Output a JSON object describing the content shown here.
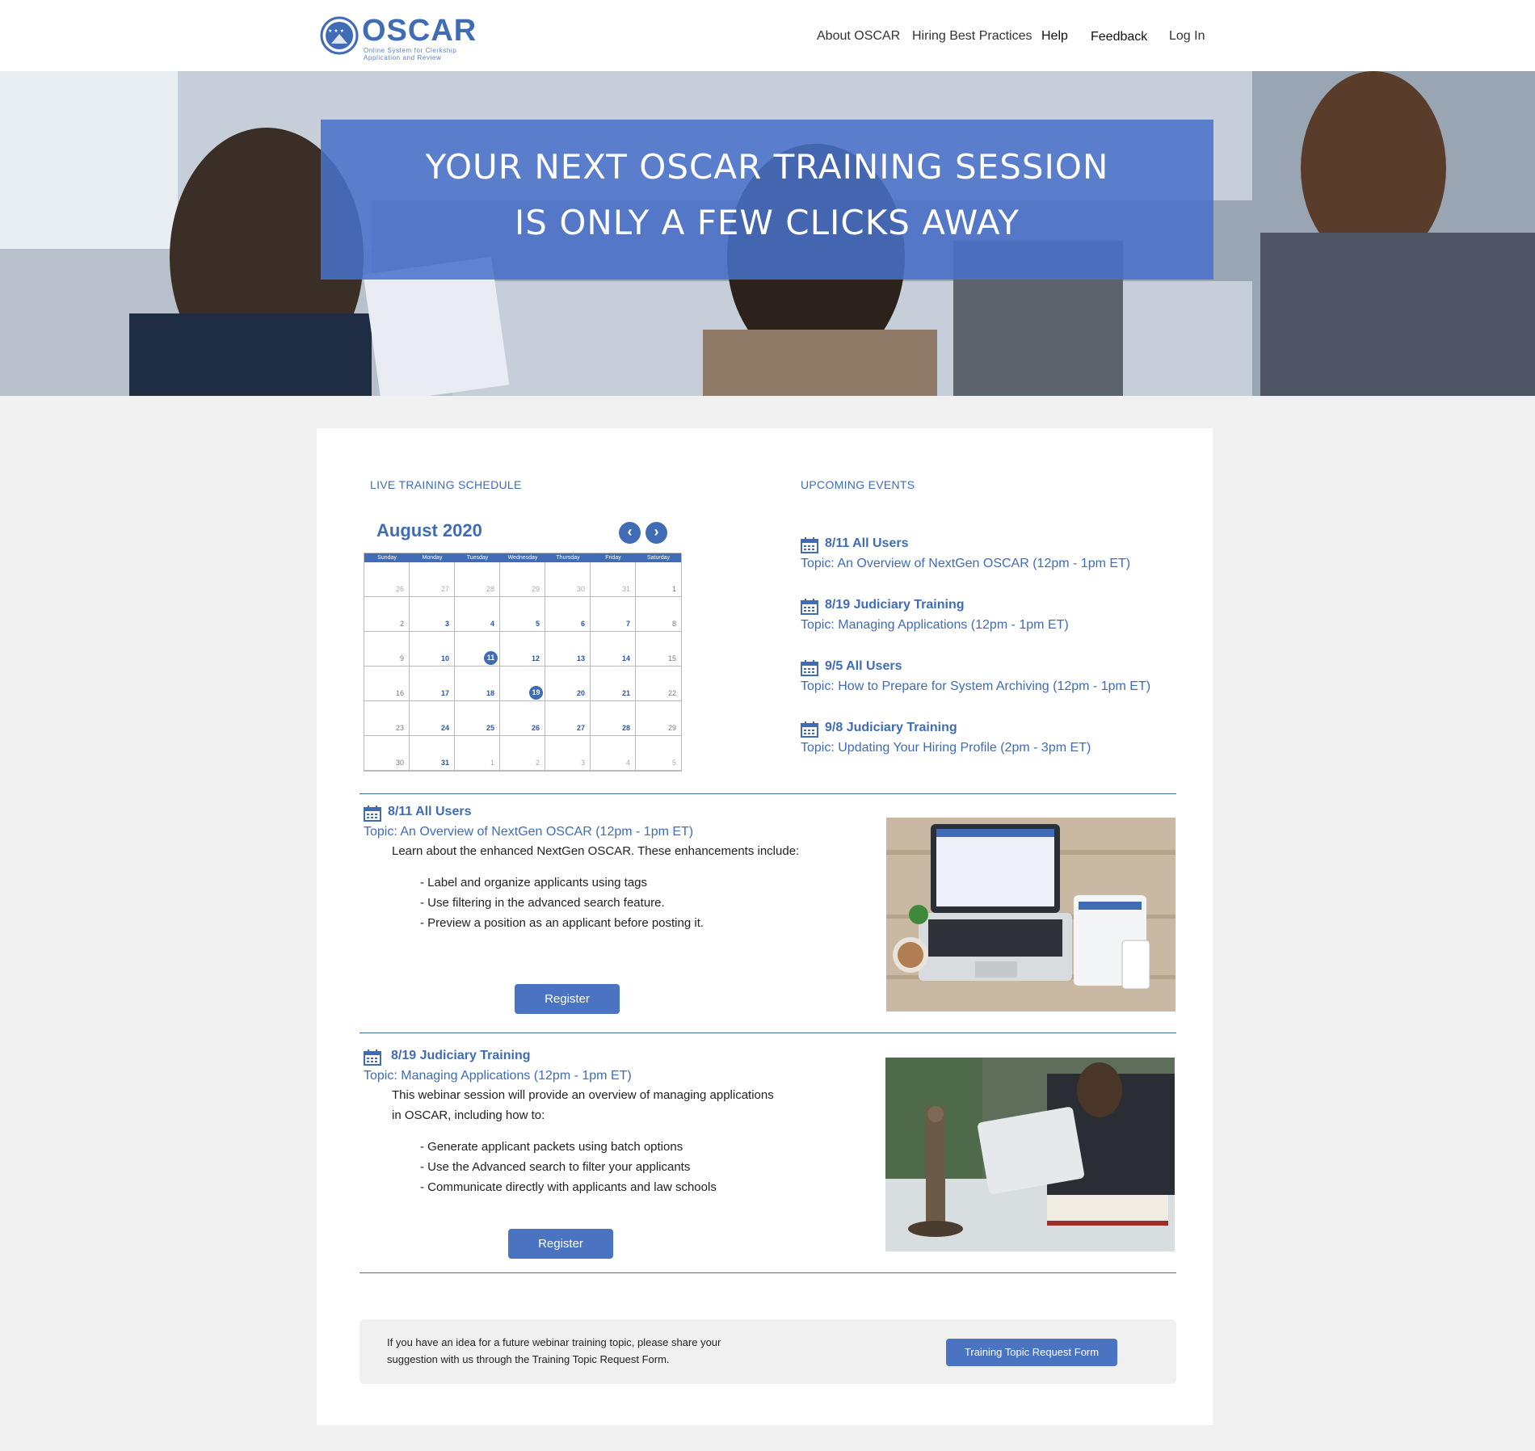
{
  "logo": {
    "word": "OSCAR",
    "tagline_1": "Online System for Clerkship",
    "tagline_2": "Application and Review"
  },
  "nav": {
    "about": "About OSCAR",
    "hiring": "Hiring Best Practices",
    "help": "Help",
    "feedback": "Feedback",
    "login": "Log In"
  },
  "hero": {
    "line1": "YOUR NEXT OSCAR TRAINING SESSION",
    "line2": "IS ONLY A FEW CLICKS AWAY"
  },
  "schedule": {
    "title": "LIVE TRAINING SCHEDULE",
    "calendar": {
      "month": "August 2020",
      "prev_icon": "chevron-left-icon",
      "next_icon": "chevron-right-icon",
      "weekdays": [
        "Sunday",
        "Monday",
        "Tuesday",
        "Wednesday",
        "Thursday",
        "Friday",
        "Saturday"
      ],
      "days": [
        "26",
        "27",
        "28",
        "29",
        "30",
        "31",
        "1",
        "2",
        "3",
        "4",
        "5",
        "6",
        "7",
        "8",
        "9",
        "10",
        "11",
        "12",
        "13",
        "14",
        "15",
        "16",
        "17",
        "18",
        "19",
        "20",
        "21",
        "22",
        "23",
        "24",
        "25",
        "26",
        "27",
        "28",
        "29",
        "30",
        "31",
        "1",
        "2",
        "3",
        "4",
        "5"
      ],
      "event_days": [
        "11",
        "19"
      ]
    }
  },
  "upcoming": {
    "title": "UPCOMING EVENTS",
    "events": [
      {
        "title": "8/11 All Users",
        "topic": "Topic: An Overview of NextGen OSCAR (12pm - 1pm ET)"
      },
      {
        "title": "8/19 Judiciary Training",
        "topic": "Topic: Managing Applications (12pm - 1pm ET)"
      },
      {
        "title": "9/5 All Users",
        "topic": "Topic: How to Prepare for System Archiving (12pm - 1pm ET)"
      },
      {
        "title": "9/8 Judiciary Training",
        "topic": "Topic: Updating Your Hiring Profile (2pm - 3pm ET)"
      }
    ]
  },
  "details": [
    {
      "title": "8/11 All Users",
      "topic": "Topic: An Overview of NextGen OSCAR (12pm - 1pm ET)",
      "desc_1": "Learn about the enhanced NextGen OSCAR. These enhancements include:",
      "desc_2": "",
      "bullets": [
        "- Label and organize applicants using tags",
        "- Use filtering in the advanced search feature.",
        "- Preview a position as an applicant before posting it."
      ],
      "button": "Register"
    },
    {
      "title": "8/19 Judiciary Training",
      "topic": "Topic: Managing Applications (12pm - 1pm ET)",
      "desc_1": "This webinar session will provide an overview of managing applications",
      "desc_2": "in OSCAR, including how to:",
      "bullets": [
        "- Generate applicant packets using batch options",
        "- Use the Advanced search to filter your applicants",
        "- Communicate directly with applicants and law schools"
      ],
      "button": "Register"
    }
  ],
  "request": {
    "text_1": "If you have an idea for a future webinar training topic, please share your",
    "text_2": "suggestion with us through the Training Topic Request Form.",
    "button": "Training Topic Request Form"
  },
  "colors": {
    "accent": "#3f6cb5",
    "button": "#4a74c2",
    "hero_overlay": "#4871c9"
  }
}
